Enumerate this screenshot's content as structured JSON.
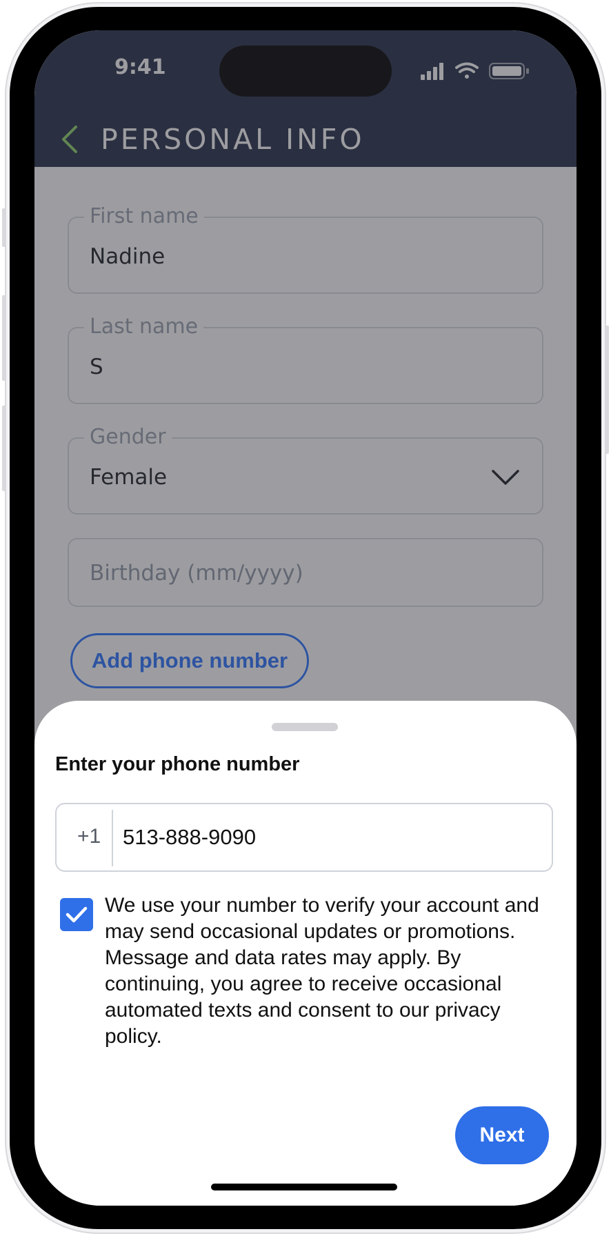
{
  "status_bar": {
    "time": "9:41"
  },
  "header": {
    "title": "PERSONAL INFO",
    "back_icon": "chevron-left-icon"
  },
  "form": {
    "first_name": {
      "label": "First name",
      "value": "Nadine"
    },
    "last_name": {
      "label": "Last name",
      "value": "S"
    },
    "gender": {
      "label": "Gender",
      "value": "Female"
    },
    "birthday": {
      "placeholder": "Birthday (mm/yyyy)"
    },
    "add_phone_label": "Add phone number"
  },
  "sheet": {
    "title": "Enter your phone number",
    "country_code": "+1",
    "phone_value": "513-888-9090",
    "consent_checked": true,
    "consent_text": "We use your number to verify your account and may send occasional updates or promotions. Message and data rates may apply. By continuing, you agree to receive occasional automated texts and consent to our privacy policy.",
    "next_label": "Next"
  },
  "colors": {
    "header_bg": "#232f48",
    "accent": "#2f6fe8",
    "back_chevron": "#8fd46a"
  }
}
